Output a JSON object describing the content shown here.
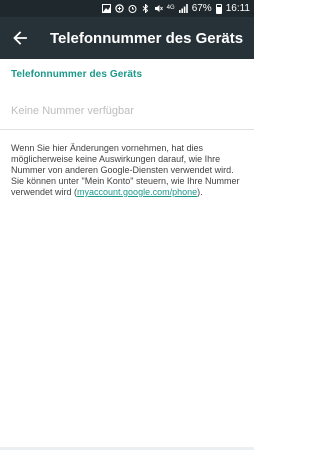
{
  "status_bar": {
    "network": "4G",
    "battery_percent": "67%",
    "time": "16:11",
    "icons": [
      "image-icon",
      "data-saver-icon",
      "alarm-icon",
      "bluetooth-icon",
      "mute-icon",
      "signal-icon",
      "battery-icon"
    ]
  },
  "app_bar": {
    "title": "Telefonnummer des Geräts",
    "back_icon": "arrow-back-icon"
  },
  "content": {
    "section_title": "Telefonnummer des Geräts",
    "phone_placeholder": "Keine Nummer verfügbar",
    "info_before_link": "Wenn Sie hier Änderungen vornehmen, hat dies möglicherweise keine Auswirkungen darauf, wie Ihre Nummer von anderen Google-Diensten verwendet wird. Sie können unter \"Mein Konto\" steuern, wie Ihre Nummer verwendet wird (",
    "info_link": "myaccount.google.com/phone",
    "info_after_link": ")."
  },
  "colors": {
    "app_bar": "#263238",
    "status_bar": "#1f282c",
    "accent": "#1a998a"
  }
}
